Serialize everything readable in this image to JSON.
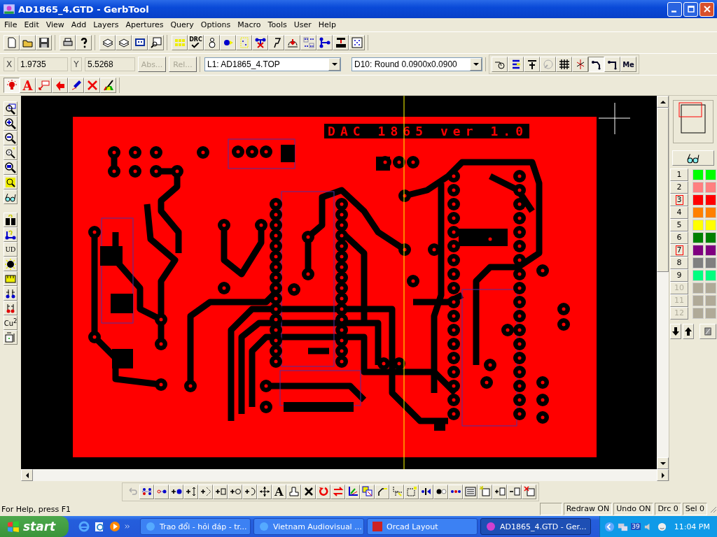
{
  "window": {
    "title": "AD1865_4.GTD - GerbTool"
  },
  "menu": [
    "File",
    "Edit",
    "View",
    "Add",
    "Layers",
    "Apertures",
    "Query",
    "Options",
    "Macro",
    "Tools",
    "User",
    "Help"
  ],
  "icon_texts": {
    "drc": "DRC",
    "text_tool": "A",
    "ud": "UD",
    "copper": "Cu$^{2}$",
    "bottom_text_tool": "A",
    "me": "Me"
  },
  "coords": {
    "x_label": "X",
    "x_value": "1.9735",
    "y_label": "Y",
    "y_value": "5.5268"
  },
  "coord_buttons": [
    {
      "label": "Abs...",
      "disabled": true
    },
    {
      "label": "Rel...",
      "disabled": true
    }
  ],
  "layer_select": {
    "value": "L1: AD1865_4.TOP"
  },
  "aperture_select": {
    "value": "D10: Round 0.0900x0.0900"
  },
  "board": {
    "label": "DAC 1865 ver 1.0"
  },
  "layers": [
    {
      "number": "1",
      "color": "#00ff00",
      "marked": false,
      "enabled": true
    },
    {
      "number": "2",
      "color": "#ff8080",
      "marked": false,
      "enabled": true
    },
    {
      "number": "3",
      "color": "#ff0000",
      "marked": true,
      "enabled": true
    },
    {
      "number": "4",
      "color": "#ff8000",
      "marked": false,
      "enabled": true
    },
    {
      "number": "5",
      "color": "#ffff00",
      "marked": false,
      "enabled": true
    },
    {
      "number": "6",
      "color": "#008000",
      "marked": false,
      "enabled": true
    },
    {
      "number": "7",
      "color": "#800080",
      "marked": true,
      "enabled": true
    },
    {
      "number": "8",
      "color": "#808080",
      "marked": false,
      "enabled": true
    },
    {
      "number": "9",
      "color": "#00ff80",
      "marked": false,
      "enabled": true
    },
    {
      "number": "10",
      "color": "#b0aa98",
      "marked": false,
      "enabled": false
    },
    {
      "number": "11",
      "color": "#b0aa98",
      "marked": false,
      "enabled": false
    },
    {
      "number": "12",
      "color": "#b0aa98",
      "marked": false,
      "enabled": false
    }
  ],
  "status_bar": {
    "help": "For Help, press F1",
    "panes": [
      "Redraw ON",
      "Undo ON",
      "Drc 0",
      "Sel 0"
    ]
  },
  "taskbar": {
    "start": "start",
    "tasks": [
      {
        "label": "Trao đổi - hỏi đáp - tr...",
        "selected": false
      },
      {
        "label": "Vietnam Audiovisual ...",
        "selected": false
      },
      {
        "label": "Orcad Layout",
        "selected": false
      },
      {
        "label": "AD1865_4.GTD - Ger...",
        "selected": true
      }
    ],
    "tray_number": "39",
    "clock": "11:04 PM"
  }
}
